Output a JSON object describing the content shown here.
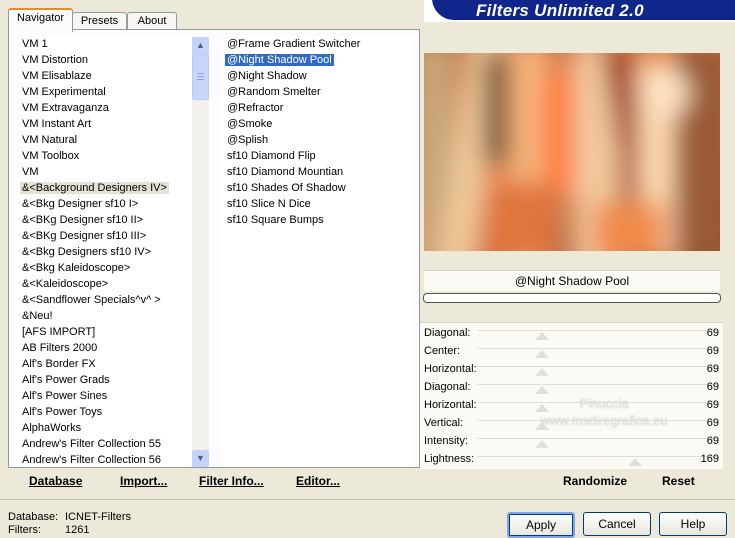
{
  "header": {
    "title": "Filters Unlimited 2.0"
  },
  "tabs": [
    {
      "label": "Navigator",
      "active": true
    },
    {
      "label": "Presets",
      "active": false
    },
    {
      "label": "About",
      "active": false
    }
  ],
  "categories": [
    "VM 1",
    "VM Distortion",
    "VM Elisablaze",
    "VM Experimental",
    "VM Extravaganza",
    "VM Instant Art",
    "VM Natural",
    "VM Toolbox",
    "VM",
    "&<Background Designers IV>",
    "&<Bkg Designer sf10 I>",
    "&<BKg Designer sf10 II>",
    "&<BKg Designer sf10 III>",
    "&<Bkg Designers sf10 IV>",
    "&<Bkg Kaleidoscope>",
    "&<Kaleidoscope>",
    "&<Sandflower Specials^v^ >",
    "&Neu!",
    "[AFS IMPORT]",
    "AB Filters 2000",
    "Alf's Border FX",
    "Alf's Power Grads",
    "Alf's Power Sines",
    "Alf's Power Toys",
    "AlphaWorks",
    "Andrew's Filter Collection 55",
    "Andrew's Filter Collection 56"
  ],
  "filters": [
    "@Frame Gradient Switcher",
    "@Night Shadow Pool",
    "@Night Shadow",
    "@Random Smelter",
    "@Refractor",
    "@Smoke",
    "@Splish",
    "sf10 Diamond Flip",
    "sf10 Diamond Mountian",
    "sf10 Shades Of Shadow",
    "sf10 Slice N Dice",
    "sf10 Square Bumps"
  ],
  "bottom_buttons": {
    "database": "Database",
    "import": "Import...",
    "filter_info": "Filter Info...",
    "editor": "Editor..."
  },
  "preview": {
    "filter_name": "@Night Shadow Pool",
    "progress": 0
  },
  "params": [
    {
      "label": "Diagonal:",
      "value": "69",
      "fraction": 0.27
    },
    {
      "label": "Center:",
      "value": "69",
      "fraction": 0.27
    },
    {
      "label": "Horizontal:",
      "value": "69",
      "fraction": 0.27
    },
    {
      "label": "Diagonal:",
      "value": "69",
      "fraction": 0.27
    },
    {
      "label": "Horizontal:",
      "value": "69",
      "fraction": 0.27
    },
    {
      "label": "Vertical:",
      "value": "69",
      "fraction": 0.27
    },
    {
      "label": "Intensity:",
      "value": "69",
      "fraction": 0.27
    },
    {
      "label": "Lightness:",
      "value": "169",
      "fraction": 0.66
    }
  ],
  "actions": {
    "randomize": "Randomize",
    "reset": "Reset"
  },
  "status": {
    "database_label": "Database:",
    "database_value": "ICNET-Filters",
    "filters_label": "Filters:",
    "filters_value": "1261"
  },
  "dialog_buttons": {
    "apply": "Apply",
    "cancel": "Cancel",
    "help": "Help"
  },
  "watermark": {
    "line1": "Pinuccia",
    "line2": "www.msdiregrafica.eu"
  }
}
